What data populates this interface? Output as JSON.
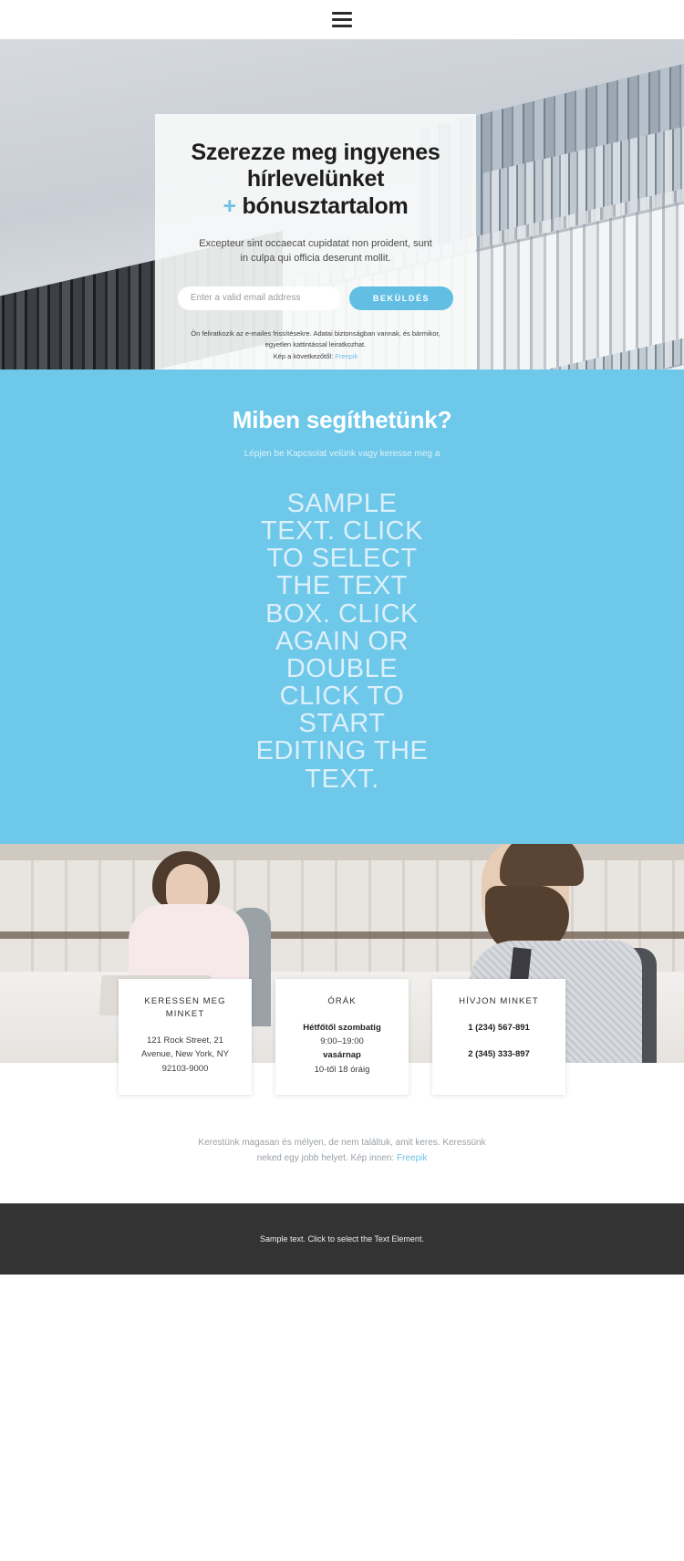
{
  "topbar": {
    "menu_icon": "hamburger-menu-icon"
  },
  "hero": {
    "title_line1": "Szerezze meg ingyenes",
    "title_line2": "hírlevelünket",
    "title_plus": "+",
    "title_line3": "bónusztartalom",
    "subtitle": "Excepteur sint occaecat cupidatat non proident, sunt in culpa qui officia deserunt mollit.",
    "email_placeholder": "Enter a valid email address",
    "email_value": "",
    "submit_label": "BEKÜLDÉS",
    "fineprint_line1": "Ön feliratkozik az e-mailes frissítésekre. Adatai biztonságban vannak, és bármikor,",
    "fineprint_line2": "egyetlen kattintással leiratkozhat.",
    "fineprint_line3_prefix": "Kép a következőtől: ",
    "fineprint_link": "Freepik"
  },
  "blue_section": {
    "title": "Miben segíthetünk?",
    "subtitle": "Lépjen be Kapcsolat velünk vagy keresse meg a",
    "body": "SAMPLE TEXT. CLICK TO SELECT THE TEXT BOX. CLICK AGAIN OR DOUBLE CLICK TO START EDITING THE TEXT.",
    "background_color": "#6ec8ea"
  },
  "contact_cards": [
    {
      "title": "KERESSEN MEG MINKET",
      "lines": [
        {
          "text": "121 Rock Street, 21",
          "bold": false,
          "spaced": false
        },
        {
          "text": "Avenue, New York, NY",
          "bold": false,
          "spaced": false
        },
        {
          "text": "92103-9000",
          "bold": false,
          "spaced": false
        }
      ]
    },
    {
      "title": "ÓRÁK",
      "lines": [
        {
          "text": "Hétfőtől szombatig",
          "bold": true,
          "spaced": false
        },
        {
          "text": "9:00–19:00",
          "bold": false,
          "spaced": false
        },
        {
          "text": "vasárnap",
          "bold": true,
          "spaced": false
        },
        {
          "text": "10-től 18 óráig",
          "bold": false,
          "spaced": false
        }
      ]
    },
    {
      "title": "HÍVJON MINKET",
      "lines": [
        {
          "text": "1 (234) 567-891",
          "bold": true,
          "spaced": false
        },
        {
          "text": "2 (345) 333-897",
          "bold": true,
          "spaced": true
        }
      ]
    }
  ],
  "bottom_note": {
    "line1": "Kerestünk magasan és mélyen, de nem találtuk, amit keres. Keressünk",
    "line2_prefix": "neked egy jobb helyet. Kép innen: ",
    "link": "Freepik"
  },
  "footer": {
    "text": "Sample text. Click to select the Text Element."
  },
  "colors": {
    "accent": "#6ec1e4",
    "blue_section": "#6ec8ea",
    "footer_bg": "#333333"
  }
}
